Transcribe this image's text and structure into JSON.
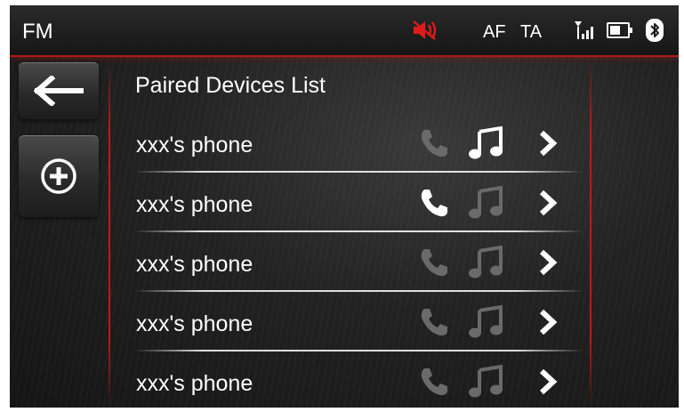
{
  "status_bar": {
    "source": "FM",
    "af": "AF",
    "ta": "TA",
    "mute_icon": "speaker-muted-icon",
    "signal_icon": "signal-strength-icon",
    "battery_icon": "battery-icon",
    "bluetooth_icon": "bluetooth-icon",
    "mute_color": "#e01b1b"
  },
  "side_buttons": {
    "back_icon": "arrow-left-icon",
    "add_icon": "plus-circle-icon"
  },
  "list": {
    "title": "Paired Devices List",
    "devices": [
      {
        "name": "xxx's phone",
        "phone_active": false,
        "music_active": true
      },
      {
        "name": "xxx's phone",
        "phone_active": true,
        "music_active": false
      },
      {
        "name": "xxx's phone",
        "phone_active": false,
        "music_active": false
      },
      {
        "name": "xxx's phone",
        "phone_active": false,
        "music_active": false
      },
      {
        "name": "xxx's phone",
        "phone_active": false,
        "music_active": false
      }
    ]
  },
  "colors": {
    "accent_red": "#c01818",
    "icon_active": "#ffffff",
    "icon_inactive": "#6a6a6a"
  }
}
